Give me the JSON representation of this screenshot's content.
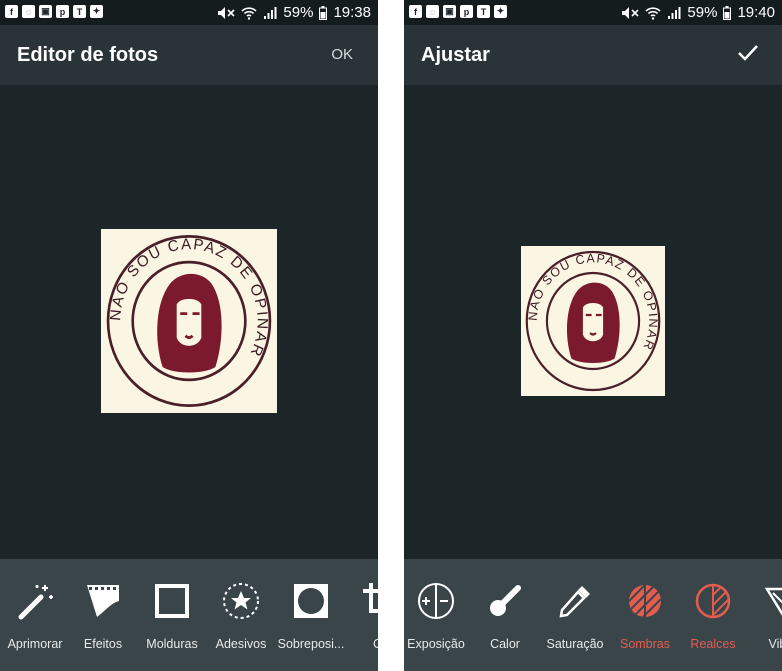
{
  "status_bar": {
    "notification_icons": [
      "facebook-icon",
      "whatsapp-icon",
      "gallery-icon",
      "pinterest-icon",
      "nytimes-icon",
      "twitter-icon"
    ],
    "battery_percent": "59%",
    "left_time": "19:38",
    "right_time": "19:40"
  },
  "left_screen": {
    "title": "Editor de fotos",
    "ok_label": "OK",
    "photo_text": "NÃO SOU CAPAZ DE OPINAR",
    "tools": [
      {
        "label": "Aprimorar",
        "icon": "magic-wand-icon"
      },
      {
        "label": "Efeitos",
        "icon": "film-icon"
      },
      {
        "label": "Molduras",
        "icon": "frame-icon"
      },
      {
        "label": "Adesivos",
        "icon": "sticker-star-icon"
      },
      {
        "label": "Sobreposi...",
        "icon": "overlay-icon"
      },
      {
        "label": "Co",
        "icon": "crop-icon"
      }
    ]
  },
  "right_screen": {
    "title": "Ajustar",
    "confirm_icon": "checkmark-icon",
    "photo_text": "NÃO SOU CAPAZ DE OPINAR",
    "tools": [
      {
        "label": "Exposição",
        "icon": "exposure-icon",
        "active": false
      },
      {
        "label": "Calor",
        "icon": "thermometer-icon",
        "active": false
      },
      {
        "label": "Saturação",
        "icon": "eyedropper-icon",
        "active": false
      },
      {
        "label": "Sombras",
        "icon": "shadows-icon",
        "active": true
      },
      {
        "label": "Realces",
        "icon": "highlights-icon",
        "active": true
      },
      {
        "label": "Vibra",
        "icon": "vibrance-icon",
        "active": false
      }
    ]
  },
  "colors": {
    "background": "#1c2528",
    "toolbar": "#2a3438",
    "tool_tray": "#3a4549",
    "accent_active": "#e35d4f",
    "stamp_ink": "#7a1a2c",
    "photo_paper": "#fbf6e4"
  }
}
